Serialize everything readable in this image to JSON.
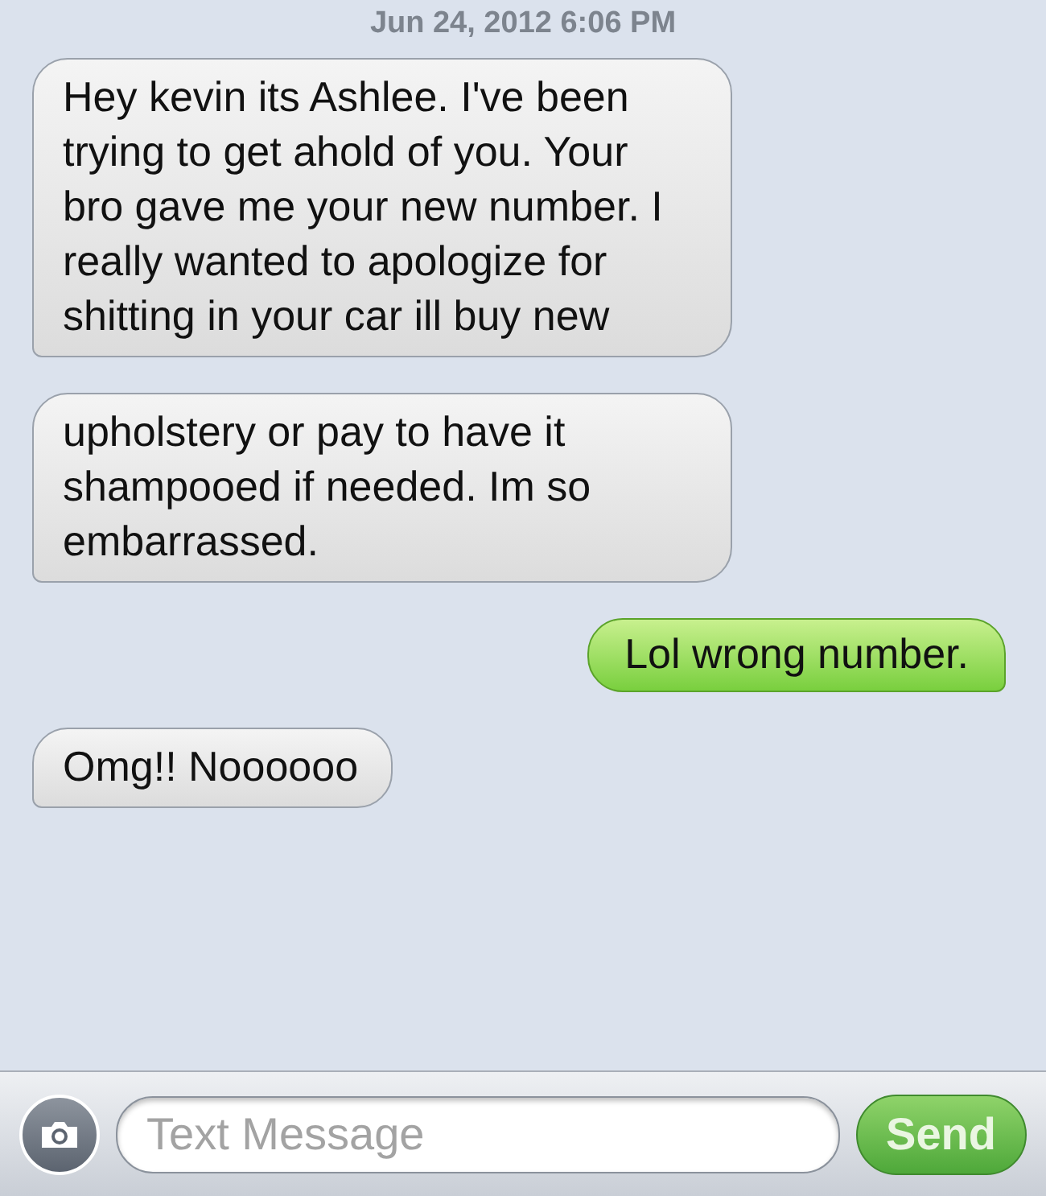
{
  "timestamp": "Jun 24, 2012 6:06 PM",
  "messages": [
    {
      "kind": "incoming",
      "text": "Hey kevin its Ashlee. I've been trying to get ahold of you. Your bro gave me your new number. I really wanted to apologize for shitting in your car ill buy new"
    },
    {
      "kind": "incoming",
      "text": "upholstery or pay to have it shampooed if needed. Im so embarrassed."
    },
    {
      "kind": "outgoing",
      "text": "Lol wrong number."
    },
    {
      "kind": "incoming",
      "text": "Omg!! Noooooo"
    }
  ],
  "composer": {
    "placeholder": "Text Message",
    "send_label": "Send"
  }
}
